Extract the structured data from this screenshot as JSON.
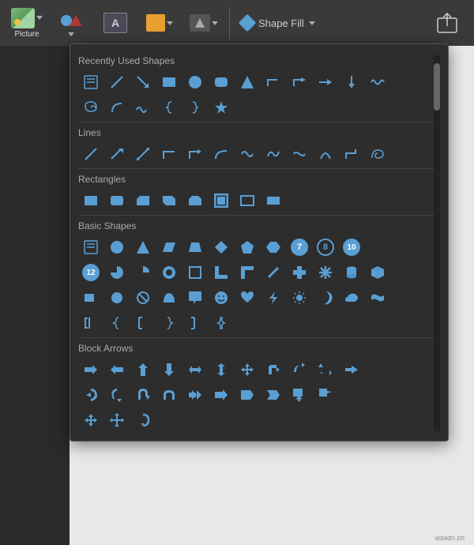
{
  "toolbar": {
    "picture_label": "Picture",
    "shape_fill_label": "Shape Fill",
    "dropdown_arrow": "▾"
  },
  "shape_picker": {
    "sections": [
      {
        "id": "recently_used",
        "label": "Recently Used Shapes",
        "rows": [
          [
            "text-box",
            "line-diagonal",
            "arrow-down-right",
            "rect-blue",
            "circle-blue",
            "rounded-rect",
            "triangle",
            "bent-line",
            "bent-arrow",
            "arrow-right",
            "arrow-down",
            "wave-shape"
          ],
          [
            "spiral",
            "arc",
            "wave",
            "brace-open",
            "brace-close",
            "star"
          ]
        ]
      },
      {
        "id": "lines",
        "label": "Lines",
        "rows": [
          [
            "line",
            "line-arrow",
            "line-double-arrow",
            "line-elbow",
            "line-elbow-arrow",
            "line-curved",
            "line-scribble",
            "line-curved2",
            "line-curved3",
            "line-arc",
            "line-rect",
            "line-loop"
          ]
        ]
      },
      {
        "id": "rectangles",
        "label": "Rectangles",
        "rows": [
          [
            "rect",
            "rect-rounded-corner",
            "rect-snip",
            "rect-snip2",
            "rect-snip3",
            "rect-frame",
            "rect-outline",
            "rect-solid"
          ]
        ]
      },
      {
        "id": "basic_shapes",
        "label": "Basic Shapes",
        "rows": [
          [
            "text-box2",
            "oval",
            "triangle2",
            "parallelogram",
            "trapezoid",
            "diamond",
            "pentagon",
            "hexagon",
            "badge-7",
            "badge-8",
            "badge-10"
          ],
          [
            "badge-12",
            "pie",
            "partial-pie",
            "donut",
            "square-outline",
            "l-shape",
            "l-shape2",
            "diagonal-slash",
            "plus",
            "snowflake",
            "cylinder",
            "cube"
          ],
          [
            "rect3",
            "circle2",
            "no-symbol",
            "arc2",
            "callout",
            "smiley",
            "heart",
            "lightning",
            "sun",
            "moon",
            "cloud",
            "wave2"
          ],
          [
            "bracket-open",
            "brace-open2",
            "bracket2",
            "brace2",
            "bracket3",
            "brace3"
          ]
        ]
      },
      {
        "id": "block_arrows",
        "label": "Block Arrows",
        "rows": [
          [
            "arrow-right2",
            "arrow-left",
            "arrow-up2",
            "arrow-down2",
            "arrow-lr",
            "arrow-ud",
            "arrow-4way",
            "arrow-bend-right",
            "arrow-curve",
            "arrow-bend-up",
            "arrow-elbow"
          ],
          [
            "arrow-cycle",
            "arrow-half-cycle",
            "arrow-u-turn",
            "arrow-n-turn",
            "arrow-striped",
            "arrow-right3",
            "arrow-pentagon",
            "arrow-chevron",
            "arrow-box",
            "arrow-callout"
          ],
          [
            "arrow-move",
            "arrow-4move",
            "arrow-uturn2"
          ]
        ]
      }
    ]
  },
  "watermark": "wsxdn.cn"
}
